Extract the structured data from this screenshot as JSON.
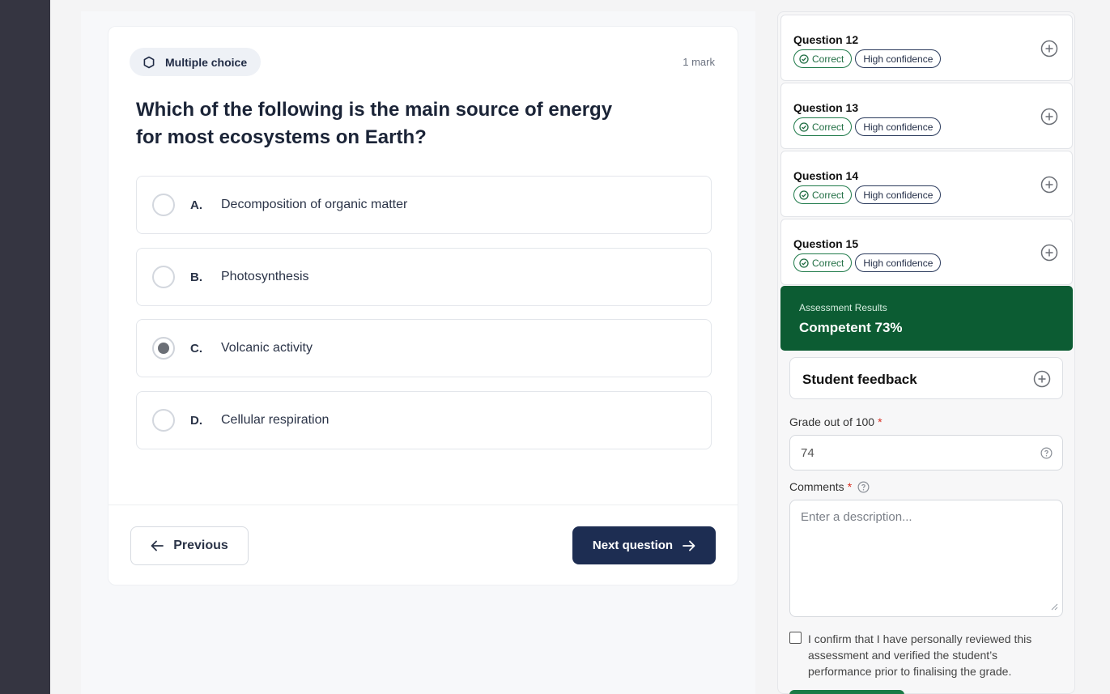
{
  "question": {
    "type_label": "Multiple choice",
    "marks": "1 mark",
    "text": "Which of the following is the main source of energy for most ecosystems on Earth?",
    "options": [
      {
        "letter": "A.",
        "text": "Decomposition of organic matter",
        "selected": false
      },
      {
        "letter": "B.",
        "text": "Photosynthesis",
        "selected": false
      },
      {
        "letter": "C.",
        "text": "Volcanic activity",
        "selected": true
      },
      {
        "letter": "D.",
        "text": "Cellular respiration",
        "selected": false
      }
    ],
    "prev_label": "Previous",
    "next_label": "Next question"
  },
  "sidebar": {
    "questions": [
      {
        "title": "Question 12",
        "status": "Correct",
        "confidence": "High confidence"
      },
      {
        "title": "Question 13",
        "status": "Correct",
        "confidence": "High confidence"
      },
      {
        "title": "Question 14",
        "status": "Correct",
        "confidence": "High confidence"
      },
      {
        "title": "Question 15",
        "status": "Correct",
        "confidence": "High confidence"
      }
    ],
    "results": {
      "label": "Assessment Results",
      "value": "Competent 73%"
    },
    "feedback_title": "Student feedback",
    "grade_label": "Grade out of 100",
    "grade_value": "74",
    "comments_label": "Comments",
    "comments_placeholder": "Enter a description...",
    "required_mark": "*",
    "confirm_text": "I confirm that I have personally reviewed this assessment and verified the student’s performance prior to finalising the grade.",
    "colors": {
      "results_bg": "#0c5c33",
      "correct": "#1f7a4a",
      "primary": "#1d2d52"
    }
  }
}
